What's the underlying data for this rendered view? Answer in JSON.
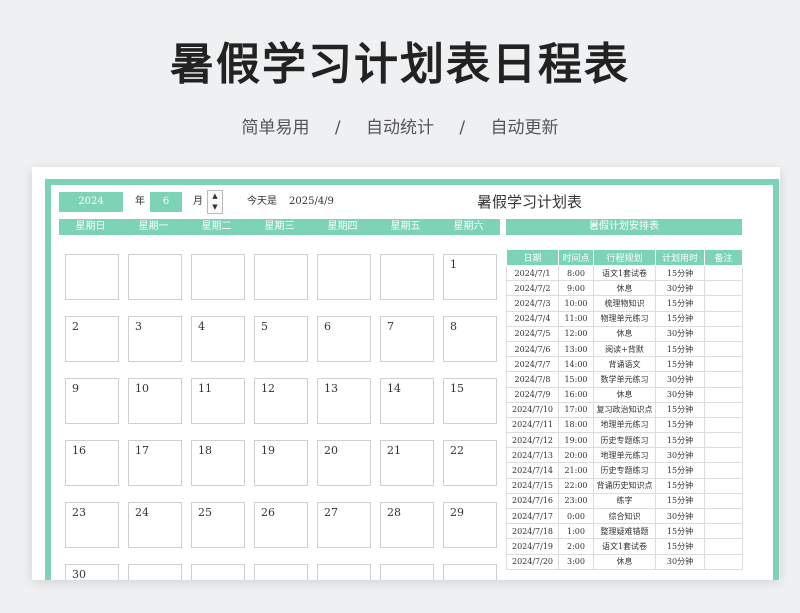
{
  "header": {
    "title": "暑假学习计划表日程表",
    "features": [
      "简单易用",
      "/",
      "自动统计",
      "/",
      "自动更新"
    ]
  },
  "controls": {
    "year_value": "2024",
    "year_label": "年",
    "month_value": "6",
    "month_label": "月",
    "spinner_up": "▲",
    "spinner_down": "▼",
    "today_label": "今天是",
    "today_value": "2025/4/9"
  },
  "calendar": {
    "title": "暑假学习计划表",
    "weekdays": [
      "星期日",
      "星期一",
      "星期二",
      "星期三",
      "星期四",
      "星期五",
      "星期六"
    ],
    "weeks": [
      [
        "",
        "",
        "",
        "",
        "",
        "",
        "1"
      ],
      [
        "2",
        "3",
        "4",
        "5",
        "6",
        "7",
        "8"
      ],
      [
        "9",
        "10",
        "11",
        "12",
        "13",
        "14",
        "15"
      ],
      [
        "16",
        "17",
        "18",
        "19",
        "20",
        "21",
        "22"
      ],
      [
        "23",
        "24",
        "25",
        "26",
        "27",
        "28",
        "29"
      ],
      [
        "30",
        "",
        "",
        "",
        "",
        "",
        ""
      ]
    ]
  },
  "schedule": {
    "title": "暑假计划安排表",
    "columns": [
      "日期",
      "时间点",
      "行程规划",
      "计划用时",
      "备注"
    ],
    "rows": [
      [
        "2024/7/1",
        "8:00",
        "语文1套试卷",
        "15分钟",
        ""
      ],
      [
        "2024/7/2",
        "9:00",
        "休息",
        "30分钟",
        ""
      ],
      [
        "2024/7/3",
        "10:00",
        "梳理物知识",
        "15分钟",
        ""
      ],
      [
        "2024/7/4",
        "11:00",
        "物理单元练习",
        "15分钟",
        ""
      ],
      [
        "2024/7/5",
        "12:00",
        "休息",
        "30分钟",
        ""
      ],
      [
        "2024/7/6",
        "13:00",
        "阅读+背默",
        "15分钟",
        ""
      ],
      [
        "2024/7/7",
        "14:00",
        "背诵语文",
        "15分钟",
        ""
      ],
      [
        "2024/7/8",
        "15:00",
        "数学单元练习",
        "30分钟",
        ""
      ],
      [
        "2024/7/9",
        "16:00",
        "休息",
        "30分钟",
        ""
      ],
      [
        "2024/7/10",
        "17:00",
        "复习政治知识点",
        "15分钟",
        ""
      ],
      [
        "2024/7/11",
        "18:00",
        "地理单元练习",
        "15分钟",
        ""
      ],
      [
        "2024/7/12",
        "19:00",
        "历史专题练习",
        "15分钟",
        ""
      ],
      [
        "2024/7/13",
        "20:00",
        "地理单元练习",
        "30分钟",
        ""
      ],
      [
        "2024/7/14",
        "21:00",
        "历史专题练习",
        "15分钟",
        ""
      ],
      [
        "2024/7/15",
        "22:00",
        "背诵历史知识点",
        "15分钟",
        ""
      ],
      [
        "2024/7/16",
        "23:00",
        "练字",
        "15分钟",
        ""
      ],
      [
        "2024/7/17",
        "0:00",
        "综合知识",
        "30分钟",
        ""
      ],
      [
        "2024/7/18",
        "1:00",
        "整理疑难错题",
        "15分钟",
        ""
      ],
      [
        "2024/7/19",
        "2:00",
        "语文1套试卷",
        "15分钟",
        ""
      ],
      [
        "2024/7/20",
        "3:00",
        "休息",
        "30分钟",
        ""
      ]
    ]
  }
}
